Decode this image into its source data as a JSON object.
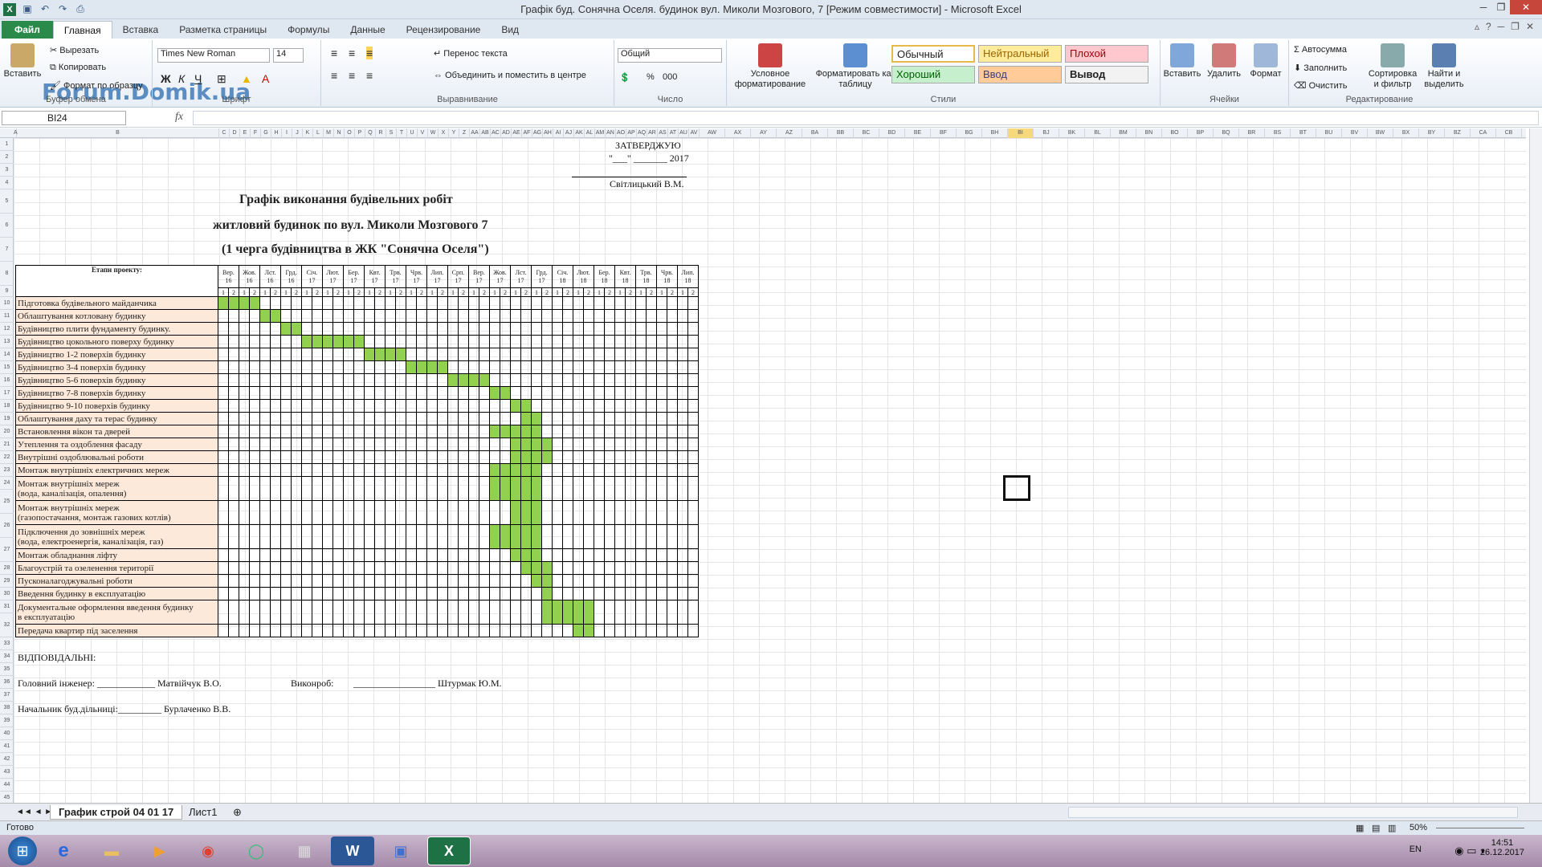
{
  "window": {
    "title": "Графік буд. Сонячна Оселя. будинок вул. Миколи Мозгового, 7  [Режим совместимости]  -  Microsoft Excel"
  },
  "tabs": [
    "Файл",
    "Главная",
    "Вставка",
    "Разметка страницы",
    "Формулы",
    "Данные",
    "Рецензирование",
    "Вид"
  ],
  "ribbon": {
    "clipboard": {
      "paste": "Вставить",
      "cut": "Вырезать",
      "copy": "Копировать",
      "format_painter": "Формат по образцу",
      "label": "Буфер обмена"
    },
    "font": {
      "name": "Times New Roman",
      "size": "14",
      "label": "Шрифт"
    },
    "alignment": {
      "wrap": "Перенос текста",
      "merge": "Объединить и поместить в центре",
      "label": "Выравнивание"
    },
    "number": {
      "format": "Общий",
      "label": "Число"
    },
    "styles": {
      "cond": "Условное форматирование",
      "table": "Форматировать как таблицу",
      "normal": "Обычный",
      "neutral": "Нейтральный",
      "bad": "Плохой",
      "good": "Хороший",
      "input": "Ввод",
      "output": "Вывод",
      "label": "Стили"
    },
    "cells": {
      "insert": "Вставить",
      "delete": "Удалить",
      "format": "Формат",
      "label": "Ячейки"
    },
    "editing": {
      "autosum": "Автосумма",
      "fill": "Заполнить",
      "clear": "Очистить",
      "sort": "Сортировка и фильтр",
      "find": "Найти и выделить",
      "label": "Редактирование"
    },
    "watermark": "Forum.Domik.ua"
  },
  "formula_bar": {
    "cell_ref": "BI24",
    "fx": "fx",
    "value": ""
  },
  "doc": {
    "approve": "ЗАТВЕРДЖУЮ",
    "date_line": "\"___\" _______ 2017",
    "approver": "Світлицький В.М.",
    "title1": "Графік виконання будівельних робіт",
    "title2": "житловий будинок по вул. Миколи Мозгового 7",
    "title3": "(1 черга будівництва в ЖК \"Сонячна Оселя\")",
    "stage_header": "Етапи проекту:",
    "months": [
      [
        "Вер.",
        "16"
      ],
      [
        "Жов.",
        "16"
      ],
      [
        "Лст.",
        "16"
      ],
      [
        "Грд.",
        "16"
      ],
      [
        "Січ.",
        "17"
      ],
      [
        "Лют.",
        "17"
      ],
      [
        "Бер.",
        "17"
      ],
      [
        "Квт.",
        "17"
      ],
      [
        "Трв.",
        "17"
      ],
      [
        "Чрв.",
        "17"
      ],
      [
        "Лип.",
        "17"
      ],
      [
        "Срп.",
        "17"
      ],
      [
        "Вер.",
        "17"
      ],
      [
        "Жов.",
        "17"
      ],
      [
        "Лст.",
        "17"
      ],
      [
        "Грд.",
        "17"
      ],
      [
        "Січ.",
        "18"
      ],
      [
        "Лют.",
        "18"
      ],
      [
        "Бер.",
        "18"
      ],
      [
        "Квт.",
        "18"
      ],
      [
        "Трв.",
        "18"
      ],
      [
        "Чрв.",
        "18"
      ],
      [
        "Лип.",
        "18"
      ]
    ],
    "stages": [
      {
        "name": "Підготовка будівельного майданчика",
        "fill": [
          10,
          11,
          12,
          13
        ]
      },
      {
        "name": "Облаштування котловану будинку",
        "fill": [
          14,
          15
        ]
      },
      {
        "name": "Будівництво плити фундаменту будинку.",
        "fill": [
          16,
          17
        ]
      },
      {
        "name": "Будівництво цокольного поверху будинку",
        "fill": [
          18,
          19,
          20,
          21,
          22,
          23
        ]
      },
      {
        "name": "Будівництво 1-2 поверхів будинку",
        "fill": [
          24,
          25,
          26,
          27
        ]
      },
      {
        "name": "Будівництво 3-4 поверхів будинку",
        "fill": [
          28,
          29,
          30,
          31
        ]
      },
      {
        "name": "Будівництво 5-6 поверхів будинку",
        "fill": [
          32,
          33,
          34,
          35
        ]
      },
      {
        "name": "Будівництво 7-8 поверхів будинку",
        "fill": [
          36,
          37
        ]
      },
      {
        "name": "Будівництво 9-10 поверхів будинку",
        "fill": [
          38,
          39
        ]
      },
      {
        "name": "Облаштування даху та терас будинку",
        "fill": [
          39,
          40
        ]
      },
      {
        "name": "Встановлення вікон та дверей",
        "fill": [
          36,
          37,
          38,
          39,
          40
        ]
      },
      {
        "name": "Утеплення та оздоблення фасаду",
        "fill": [
          38,
          39,
          40,
          41
        ]
      },
      {
        "name": "Внутрішні оздоблювальні роботи",
        "fill": [
          38,
          39,
          40,
          41
        ]
      },
      {
        "name": "Монтаж внутрішніх електричних мереж",
        "fill": [
          36,
          37,
          38,
          39,
          40
        ]
      },
      {
        "name": "Монтаж внутрішніх мереж\n(вода, каналізація, опалення)",
        "fill": [
          36,
          37,
          38,
          39,
          40
        ],
        "tall": true
      },
      {
        "name": "Монтаж внутрішніх мереж\n(газопостачання, монтаж газових котлів)",
        "fill": [
          38,
          39,
          40
        ],
        "tall": true
      },
      {
        "name": "Підключення до зовнішніх мереж\n(вода, електроенергія, каналізація, газ)",
        "fill": [
          36,
          37,
          38,
          39,
          40
        ],
        "tall": true
      },
      {
        "name": "Монтаж обладнання ліфту",
        "fill": [
          38,
          39,
          40
        ]
      },
      {
        "name": "Благоустрій та озеленення території",
        "fill": [
          39,
          40,
          41
        ]
      },
      {
        "name": "Пусконалагоджувальні роботи",
        "fill": [
          40,
          41
        ]
      },
      {
        "name": "Введення будинку в експлуатацію",
        "fill": [
          41
        ]
      },
      {
        "name": "Документальне оформлення введення будинку\nв експлуатацію",
        "fill": [
          41,
          42,
          43,
          44,
          45
        ],
        "tall": true
      },
      {
        "name": "Передача квартир під заселення",
        "fill": [
          44,
          45
        ]
      }
    ],
    "responsible": "ВІДПОВІДАЛЬНІ:",
    "chief_eng": "Головний інженер: ____________  Матвійчук В.О.",
    "contractor": "Виконроб:",
    "contractor_name": "_________________  Штурмак Ю.М.",
    "site_chief": "Начальник буд.дільниці:_________ Бурлаченко В.В."
  },
  "sheet_tabs": [
    "График строй 04 01 17",
    "Лист1"
  ],
  "status": {
    "ready": "Готово",
    "zoom": "50%"
  },
  "tray": {
    "lang": "EN",
    "time": "14:51",
    "date": "26.12.2017"
  }
}
